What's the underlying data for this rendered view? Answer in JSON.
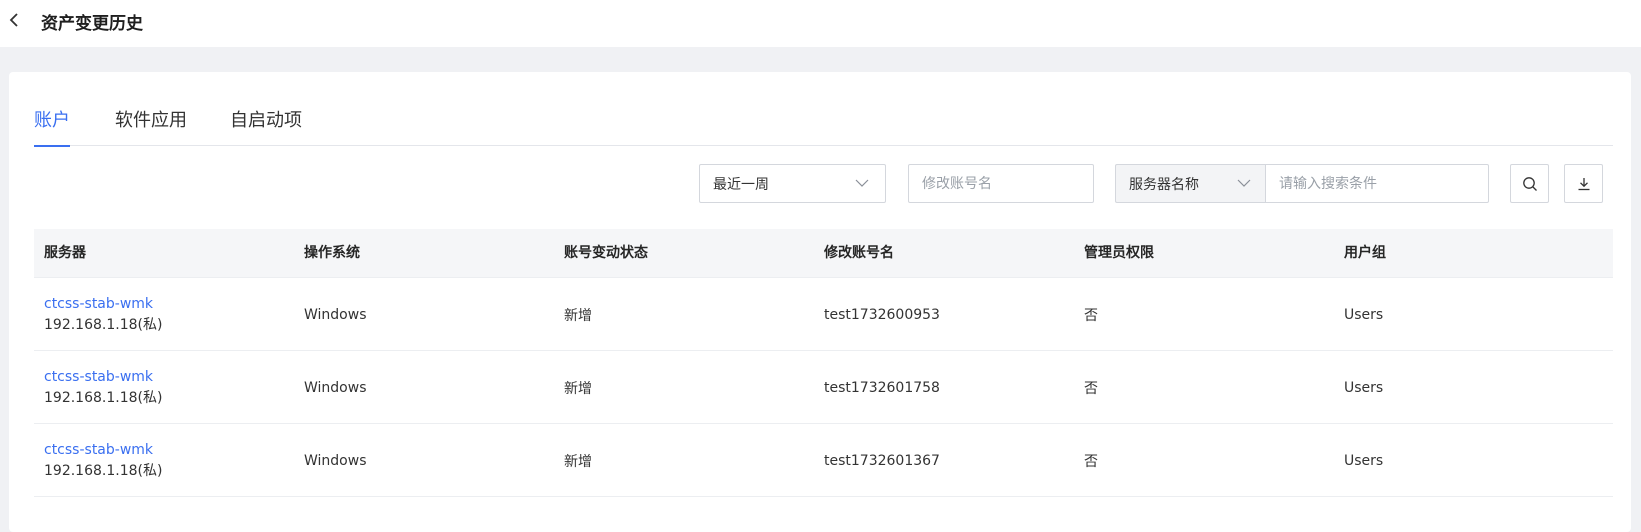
{
  "header": {
    "title": "资产变更历史"
  },
  "tabs": [
    {
      "label": "账户",
      "active": true
    },
    {
      "label": "软件应用",
      "active": false
    },
    {
      "label": "自启动项",
      "active": false
    }
  ],
  "filters": {
    "time_range": "最近一周",
    "account_placeholder": "修改账号名",
    "field_select": "服务器名称",
    "search_placeholder": "请输入搜索条件"
  },
  "table": {
    "columns": [
      "服务器",
      "操作系统",
      "账号变动状态",
      "修改账号名",
      "管理员权限",
      "用户组"
    ],
    "rows": [
      {
        "server": "ctcss-stab-wmk",
        "ip": "192.168.1.18(私)",
        "os": "Windows",
        "status": "新增",
        "account": "test1732600953",
        "admin": "否",
        "group": "Users"
      },
      {
        "server": "ctcss-stab-wmk",
        "ip": "192.168.1.18(私)",
        "os": "Windows",
        "status": "新增",
        "account": "test1732601758",
        "admin": "否",
        "group": "Users"
      },
      {
        "server": "ctcss-stab-wmk",
        "ip": "192.168.1.18(私)",
        "os": "Windows",
        "status": "新增",
        "account": "test1732601367",
        "admin": "否",
        "group": "Users"
      }
    ]
  },
  "colors": {
    "accent": "#3a6ff0",
    "header_bg": "#f5f6f8",
    "page_bg": "#f0f1f4"
  },
  "icons": {
    "back": "chevron-left-icon",
    "dropdown": "chevron-down-icon",
    "search": "search-icon",
    "download": "download-icon"
  }
}
